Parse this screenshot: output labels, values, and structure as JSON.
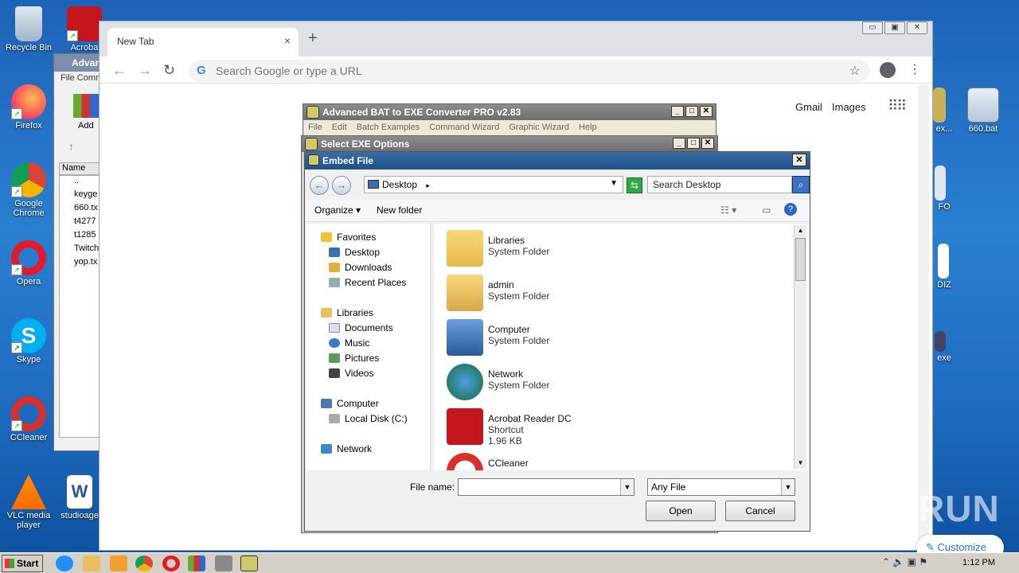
{
  "desktop": {
    "icons": [
      {
        "label": "Recycle Bin"
      },
      {
        "label": "Acroba"
      },
      {
        "label": "Firefox"
      },
      {
        "label": "Google Chrome"
      },
      {
        "label": "Opera"
      },
      {
        "label": "Skype"
      },
      {
        "label": "CCleaner"
      },
      {
        "label": "VLC media player"
      },
      {
        "label": "studioage"
      },
      {
        "label": "660.bat"
      },
      {
        "label": "ex..."
      },
      {
        "label": "FO"
      },
      {
        "label": "DIZ"
      },
      {
        "label": "exe"
      }
    ]
  },
  "chrome": {
    "tab_title": "New Tab",
    "tab_close": "×",
    "new_tab": "+",
    "window_buttons": [
      "▭",
      "▣",
      "✕"
    ],
    "omnibox_placeholder": "Search Google or type a URL",
    "gmail": "Gmail",
    "images": "Images",
    "customize": "Customize"
  },
  "winrar": {
    "title": "Advan",
    "menu": "File  Comm",
    "add_label": "Add",
    "column_name": "Name",
    "files": [
      "..",
      "keyge",
      "660.tx",
      "t4277",
      "t1285",
      "Twitch",
      "yop.tx"
    ]
  },
  "bat_converter": {
    "title": "Advanced BAT to EXE Converter PRO v2.83",
    "menu": [
      "File",
      "Edit",
      "Batch Examples",
      "Command Wizard",
      "Graphic Wizard",
      "Help"
    ]
  },
  "select_exe": {
    "title": "Select EXE Options"
  },
  "dialog": {
    "title": "Embed File",
    "address": "Desktop",
    "search_placeholder": "Search Desktop",
    "organize": "Organize",
    "new_folder": "New folder",
    "nav": {
      "favorites": "Favorites",
      "desktop": "Desktop",
      "downloads": "Downloads",
      "recent": "Recent Places",
      "libraries": "Libraries",
      "documents": "Documents",
      "music": "Music",
      "pictures": "Pictures",
      "videos": "Videos",
      "computer": "Computer",
      "local_disk": "Local Disk (C:)",
      "network": "Network"
    },
    "files": [
      {
        "name": "Libraries",
        "type": "System Folder",
        "size": ""
      },
      {
        "name": "admin",
        "type": "System Folder",
        "size": ""
      },
      {
        "name": "Computer",
        "type": "System Folder",
        "size": ""
      },
      {
        "name": "Network",
        "type": "System Folder",
        "size": ""
      },
      {
        "name": "Acrobat Reader DC",
        "type": "Shortcut",
        "size": "1.96 KB"
      },
      {
        "name": "CCleaner",
        "type": "Shortcut",
        "size": ""
      }
    ],
    "file_name_label": "File name:",
    "file_name_value": "",
    "file_type": "Any File",
    "open": "Open",
    "cancel": "Cancel"
  },
  "taskbar": {
    "start": "Start",
    "clock": "1:12 PM"
  },
  "watermark": "ANY RUN"
}
